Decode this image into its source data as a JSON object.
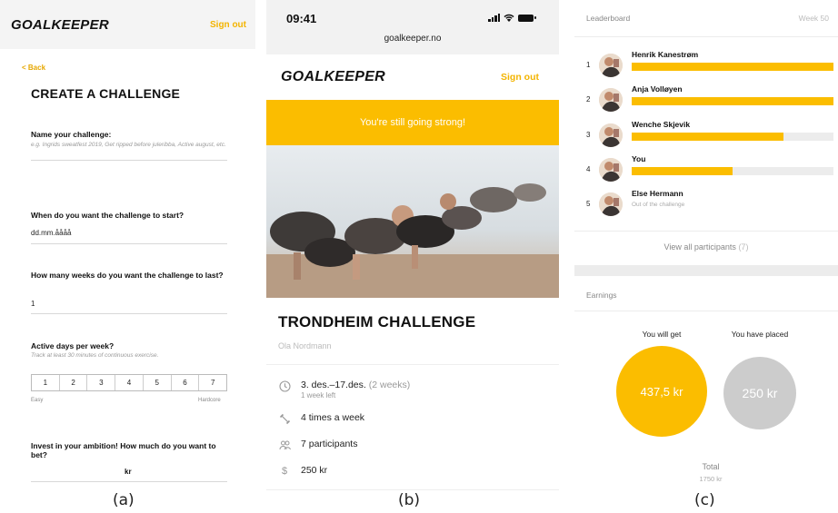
{
  "captions": {
    "a": "(a)",
    "b": "(b)",
    "c": "(c)"
  },
  "brand": {
    "logo": "GOALKEEPER",
    "sign_out": "Sign out",
    "accent": "#fbbd00"
  },
  "create": {
    "back": "< Back",
    "title": "CREATE A CHALLENGE",
    "name_label": "Name your challenge:",
    "name_hint": "e.g. Ingrids sweatfest 2019, Get ripped before juleribba, Active august, etc.",
    "start_label": "When do you want the challenge to start?",
    "start_value": "dd.mm.åååå",
    "weeks_label": "How many weeks do you want the challenge to last?",
    "weeks_value": "1",
    "active_label": "Active days per week?",
    "active_hint": "Track at least 30 minutes of continuous exercise.",
    "days": [
      "1",
      "2",
      "3",
      "4",
      "5",
      "6",
      "7"
    ],
    "scale_low": "Easy",
    "scale_high": "Hardcore",
    "invest_label": "Invest in your ambition! How much do you want to bet?",
    "invest_unit": "kr"
  },
  "challenge": {
    "status_time": "09:41",
    "url": "goalkeeper.no",
    "banner": "You're still going strong!",
    "title": "TRONDHEIM CHALLENGE",
    "owner": "Ola Nordmann",
    "dates": "3. des.–17.des.",
    "duration": "(2 weeks)",
    "time_left": "1 week left",
    "frequency": "4 times a week",
    "participants": "7 participants",
    "stake": "250 kr"
  },
  "leaderboard": {
    "title": "Leaderboard",
    "week": "Week  50",
    "rows": [
      {
        "rank": "1",
        "name": "Henrik Kanestrøm",
        "progress": 1.0
      },
      {
        "rank": "2",
        "name": "Anja Volløyen",
        "progress": 1.0
      },
      {
        "rank": "3",
        "name": "Wenche Skjevik",
        "progress": 0.75
      },
      {
        "rank": "4",
        "name": "You",
        "progress": 0.5
      },
      {
        "rank": "5",
        "name": "Else Hermann",
        "note": "Out of the challenge"
      }
    ],
    "view_all": "View all participants",
    "view_all_count": "(7)"
  },
  "earnings": {
    "title": "Earnings",
    "get_label": "You will get",
    "get_value": "437,5 kr",
    "placed_label": "You have placed",
    "placed_value": "250 kr",
    "total_label": "Total",
    "total_value": "1750 kr",
    "gray": "#cccccc"
  }
}
